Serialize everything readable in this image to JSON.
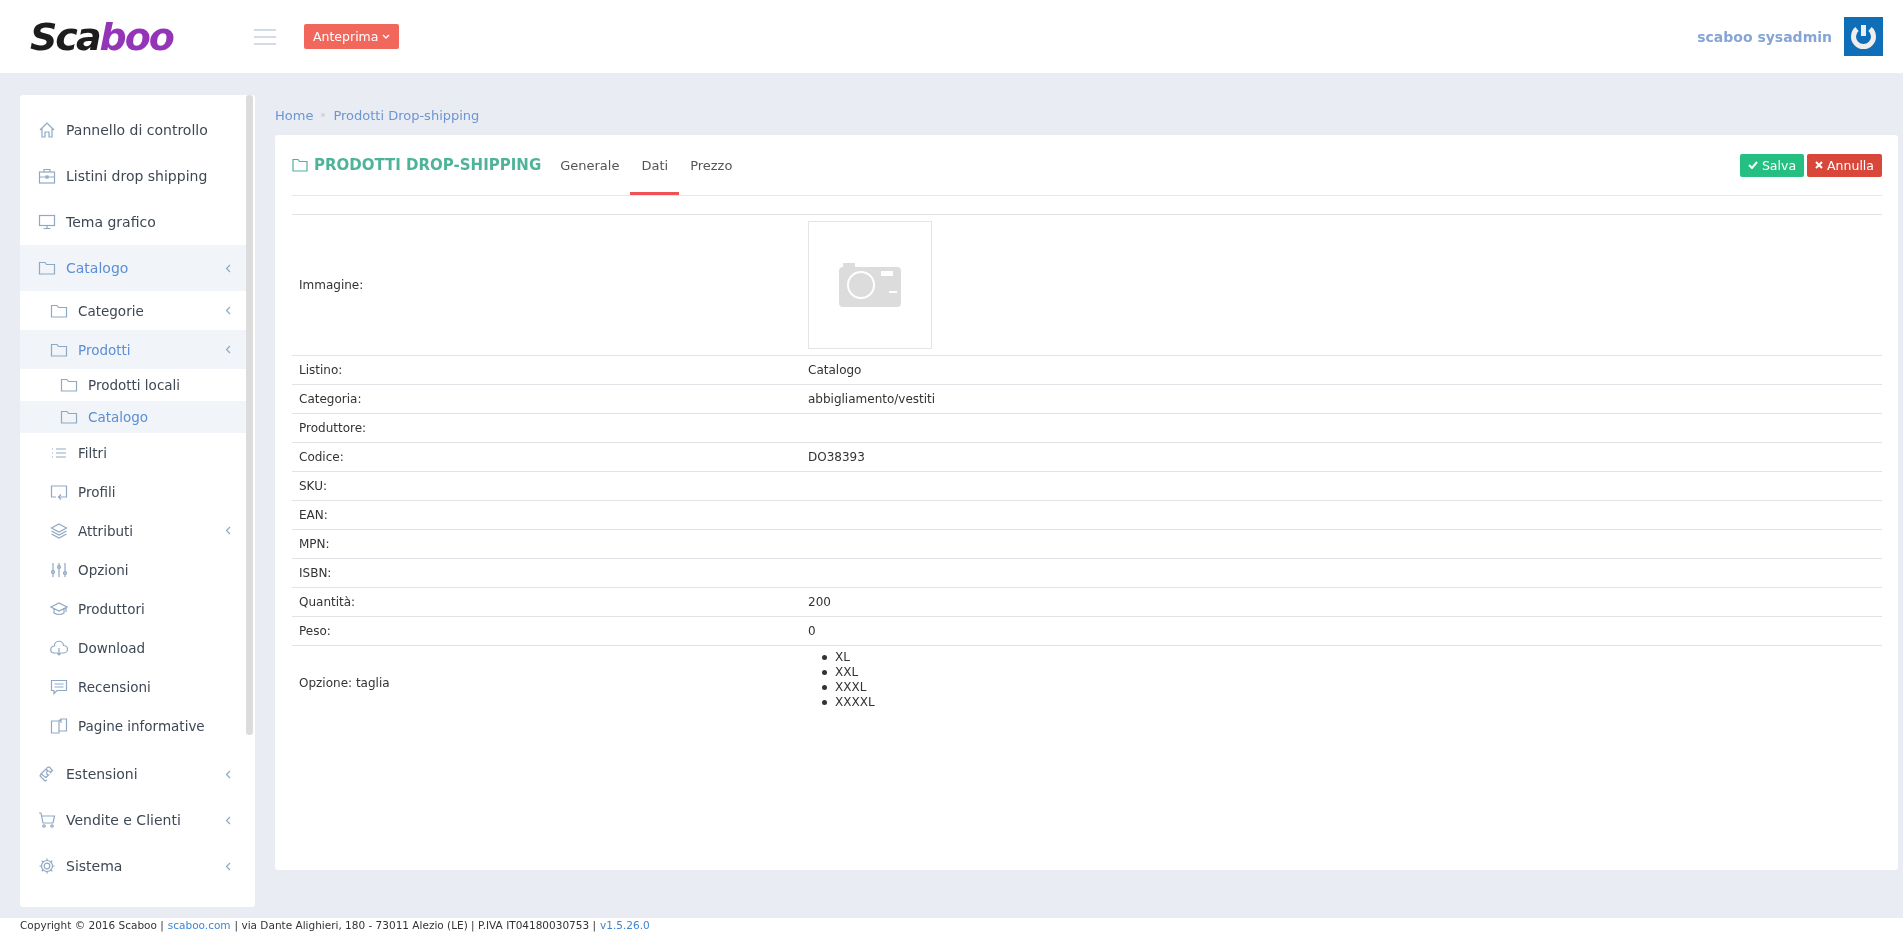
{
  "header": {
    "logo_dark": "Sca",
    "logo_accent": "boo",
    "preview_button": "Anteprima",
    "user_name": "scaboo sysadmin"
  },
  "sidebar": {
    "items": [
      {
        "label": "Pannello di controllo",
        "expandable": false,
        "selected": false
      },
      {
        "label": "Listini drop shipping",
        "expandable": false,
        "selected": false
      },
      {
        "label": "Tema grafico",
        "expandable": false,
        "selected": false
      },
      {
        "label": "Catalogo",
        "expandable": true,
        "selected": true,
        "children": [
          {
            "label": "Categorie",
            "expandable": true,
            "selected": false
          },
          {
            "label": "Prodotti",
            "expandable": true,
            "selected": true,
            "children": [
              {
                "label": "Prodotti locali",
                "expandable": false,
                "selected": false
              },
              {
                "label": "Catalogo",
                "expandable": false,
                "selected": true
              }
            ]
          },
          {
            "label": "Filtri",
            "expandable": false,
            "selected": false
          },
          {
            "label": "Profili",
            "expandable": false,
            "selected": false
          },
          {
            "label": "Attributi",
            "expandable": true,
            "selected": false
          },
          {
            "label": "Opzioni",
            "expandable": false,
            "selected": false
          },
          {
            "label": "Produttori",
            "expandable": false,
            "selected": false
          },
          {
            "label": "Download",
            "expandable": false,
            "selected": false
          },
          {
            "label": "Recensioni",
            "expandable": false,
            "selected": false
          },
          {
            "label": "Pagine informative",
            "expandable": false,
            "selected": false
          }
        ]
      },
      {
        "label": "Estensioni",
        "expandable": true,
        "selected": false
      },
      {
        "label": "Vendite e Clienti",
        "expandable": true,
        "selected": false
      },
      {
        "label": "Sistema",
        "expandable": true,
        "selected": false
      }
    ]
  },
  "breadcrumb": [
    "Home",
    "Prodotti Drop-shipping"
  ],
  "panel": {
    "title": "PRODOTTI DROP-SHIPPING",
    "tabs": [
      {
        "label": "Generale",
        "selected": false
      },
      {
        "label": "Dati",
        "selected": true
      },
      {
        "label": "Prezzo",
        "selected": false
      }
    ],
    "buttons": [
      {
        "kind": "save",
        "label": "Salva"
      },
      {
        "kind": "cancel",
        "label": "Annulla"
      }
    ],
    "rows": [
      {
        "kind": "image",
        "label": "Immagine:"
      },
      {
        "kind": "text",
        "label": "Listino:",
        "value": "Catalogo"
      },
      {
        "kind": "text",
        "label": "Categoria:",
        "value": "abbigliamento/vestiti"
      },
      {
        "kind": "text",
        "label": "Produttore:"
      },
      {
        "kind": "text",
        "label": "Codice:",
        "value": "DO38393"
      },
      {
        "kind": "text",
        "label": "SKU:"
      },
      {
        "kind": "text",
        "label": "EAN:"
      },
      {
        "kind": "text",
        "label": "MPN:"
      },
      {
        "kind": "text",
        "label": "ISBN:"
      },
      {
        "kind": "text",
        "label": "Quantità:",
        "value": "200"
      },
      {
        "kind": "text",
        "label": "Peso:",
        "value": "0"
      },
      {
        "kind": "list",
        "label": "Opzione: taglia",
        "values": [
          "XL",
          "XXL",
          "XXXL",
          "XXXXL"
        ]
      }
    ]
  },
  "footer": {
    "copyright": "Copyright © 2016 Scaboo |",
    "link": "scaboo.com",
    "address": "| via Dante Alighieri, 180 - 73011 Alezio (LE) | P.IVA IT04180030753 |",
    "version": "v1.5.26.0"
  }
}
